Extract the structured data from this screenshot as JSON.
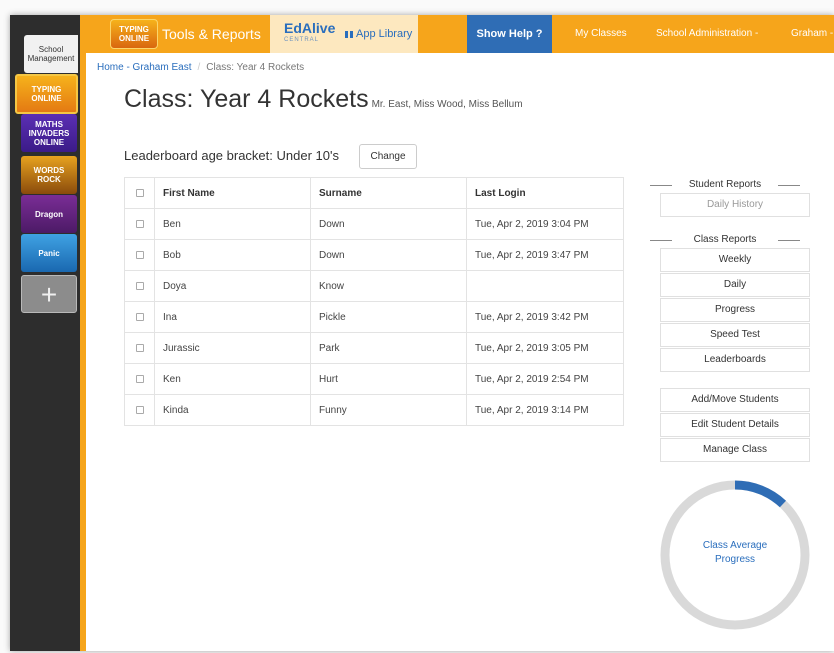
{
  "sidebar": {
    "school_label": "School Management",
    "apps": [
      {
        "name": "typing",
        "label": "TYPING ONLINE"
      },
      {
        "name": "maths",
        "label": "MATHS INVADERS ONLINE"
      },
      {
        "name": "rock",
        "label": "WORDS ROCK"
      },
      {
        "name": "dragon",
        "label": "Dragon"
      },
      {
        "name": "panic",
        "label": "Panic"
      }
    ],
    "add_label": "+"
  },
  "topnav": {
    "typing_logo": "TYPING ONLINE",
    "tools_reports": "Tools & Reports",
    "edalive": "EdAlive",
    "edalive_sub": "CENTRAL",
    "app_library": "App Library",
    "show_help": "Show Help ?",
    "my_classes": "My Classes",
    "school_admin": "School Administration -",
    "user": "Graham -"
  },
  "breadcrumb": {
    "home": "Home - Graham East",
    "current": "Class: Year 4 Rockets"
  },
  "page": {
    "title": "Class: Year 4 Rockets",
    "teachers": "Mr. East, Miss Wood, Miss Bellum",
    "age_bracket": "Leaderboard age bracket: Under 10's",
    "change_label": "Change"
  },
  "table": {
    "headers": {
      "first": "First Name",
      "surname": "Surname",
      "login": "Last Login"
    },
    "rows": [
      {
        "first": "Ben",
        "surname": "Down",
        "login": "Tue, Apr 2, 2019 3:04 PM"
      },
      {
        "first": "Bob",
        "surname": "Down",
        "login": "Tue, Apr 2, 2019 3:47 PM"
      },
      {
        "first": "Doya",
        "surname": "Know",
        "login": ""
      },
      {
        "first": "Ina",
        "surname": "Pickle",
        "login": "Tue, Apr 2, 2019 3:42 PM"
      },
      {
        "first": "Jurassic",
        "surname": "Park",
        "login": "Tue, Apr 2, 2019 3:05 PM"
      },
      {
        "first": "Ken",
        "surname": "Hurt",
        "login": "Tue, Apr 2, 2019 2:54 PM"
      },
      {
        "first": "Kinda",
        "surname": "Funny",
        "login": "Tue, Apr 2, 2019 3:14 PM"
      }
    ]
  },
  "right": {
    "student_reports_head": "Student Reports",
    "daily_history": "Daily History",
    "class_reports_head": "Class Reports",
    "weekly": "Weekly",
    "daily": "Daily",
    "progress": "Progress",
    "speed_test": "Speed Test",
    "leaderboards": "Leaderboards",
    "add_move": "Add/Move Students",
    "edit_details": "Edit Student Details",
    "manage_class": "Manage Class",
    "ring_label_1": "Class Average",
    "ring_label_2": "Progress",
    "ring_progress": 0.12
  },
  "colors": {
    "orange": "#f6a51b",
    "blue": "#2f6db5",
    "link": "#2a6ebd"
  }
}
